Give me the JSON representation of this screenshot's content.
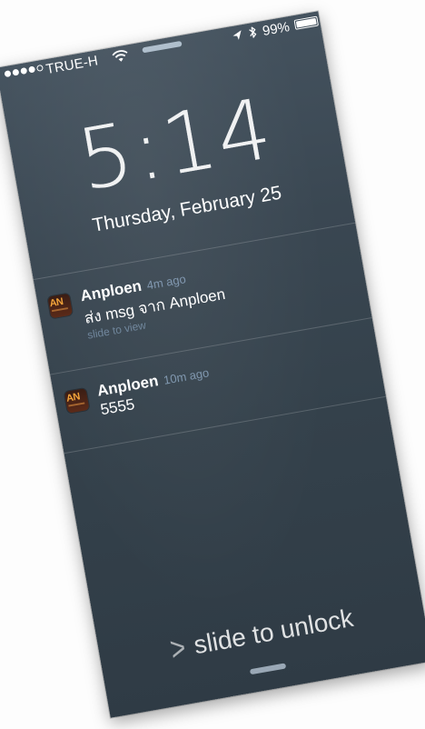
{
  "status_bar": {
    "signal_dots_filled": 4,
    "signal_dots_total": 5,
    "carrier": "TRUE-H",
    "icons": [
      "wifi-icon",
      "location-icon",
      "bluetooth-icon",
      "battery-icon"
    ],
    "battery_percent": "99%",
    "battery_level": 0.99
  },
  "lock_screen": {
    "time": "5:14",
    "date": "Thursday, February 25"
  },
  "notifications": [
    {
      "app": "Anploen",
      "time_ago": "4m ago",
      "message": "ส่ง msg จาก Anploen",
      "hint": "slide to view",
      "icon_text": "AN"
    },
    {
      "app": "Anploen",
      "time_ago": "10m ago",
      "message": "5555",
      "icon_text": "AN"
    }
  ],
  "unlock": {
    "label": "slide to unlock"
  },
  "colors": {
    "background_top": "#44525e",
    "background_bottom": "#2f3b45",
    "timestamp": "#8ca5be",
    "app_icon_accent": "#f2a33a"
  }
}
